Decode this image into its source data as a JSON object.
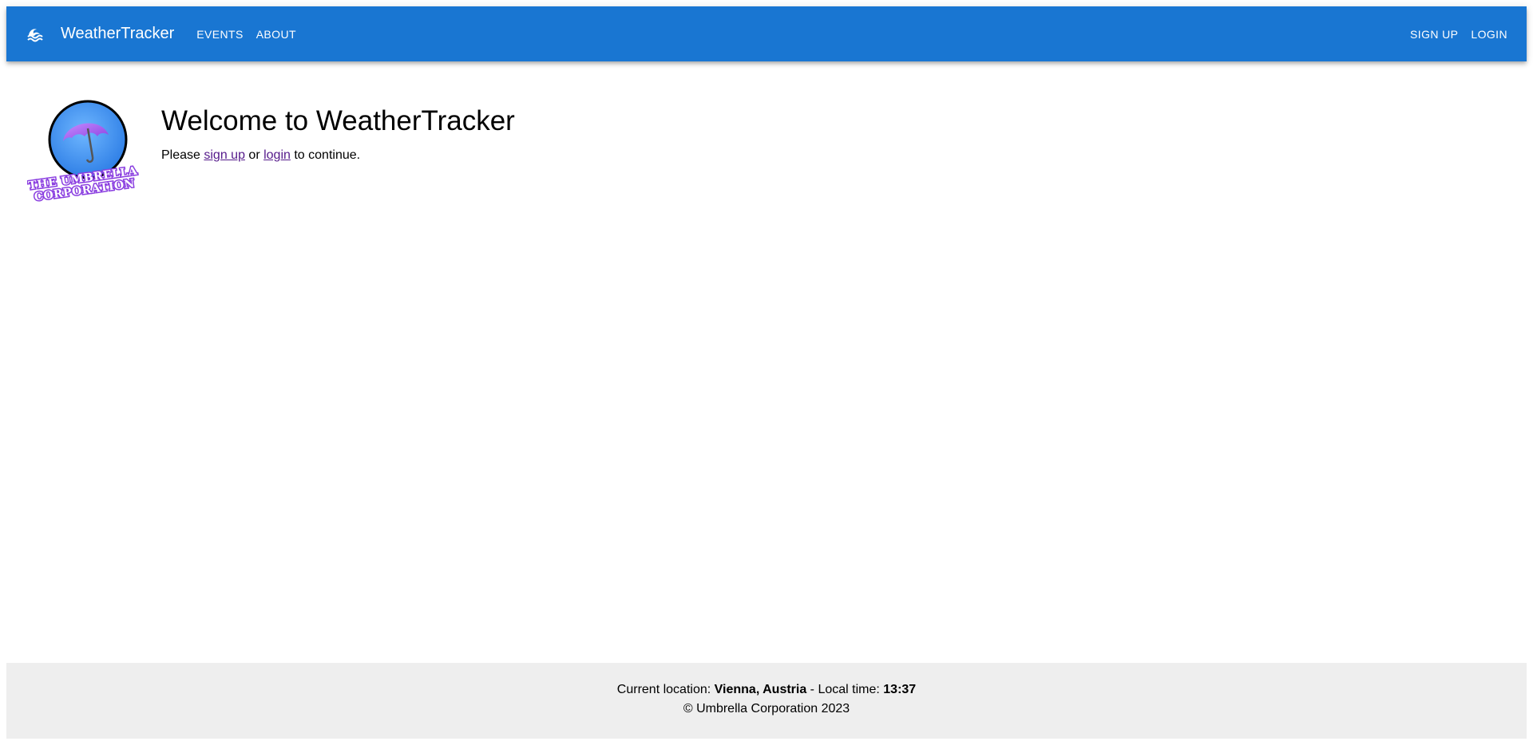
{
  "navbar": {
    "brand_icon": "waves-icon",
    "brand_title": "WeatherTracker",
    "left_links": [
      "EVENTS",
      "ABOUT"
    ],
    "right_links": [
      "SIGN UP",
      "LOGIN"
    ],
    "background_color": "#1976d2"
  },
  "main": {
    "logo": {
      "text_line_1": "THE UMBRELLA",
      "text_line_2": "CORPORATION",
      "icon": "umbrella-icon"
    },
    "heading": "Welcome to WeatherTracker",
    "message": {
      "prefix": "Please ",
      "signup_link": "sign up",
      "middle": " or ",
      "login_link": "login",
      "suffix": " to continue."
    }
  },
  "footer": {
    "location_label": "Current location: ",
    "location_value": "Vienna, Austria",
    "time_label": " - Local time: ",
    "time_value": "13:37",
    "copyright": "© Umbrella Corporation 2023",
    "background_color": "#eeeeee"
  }
}
